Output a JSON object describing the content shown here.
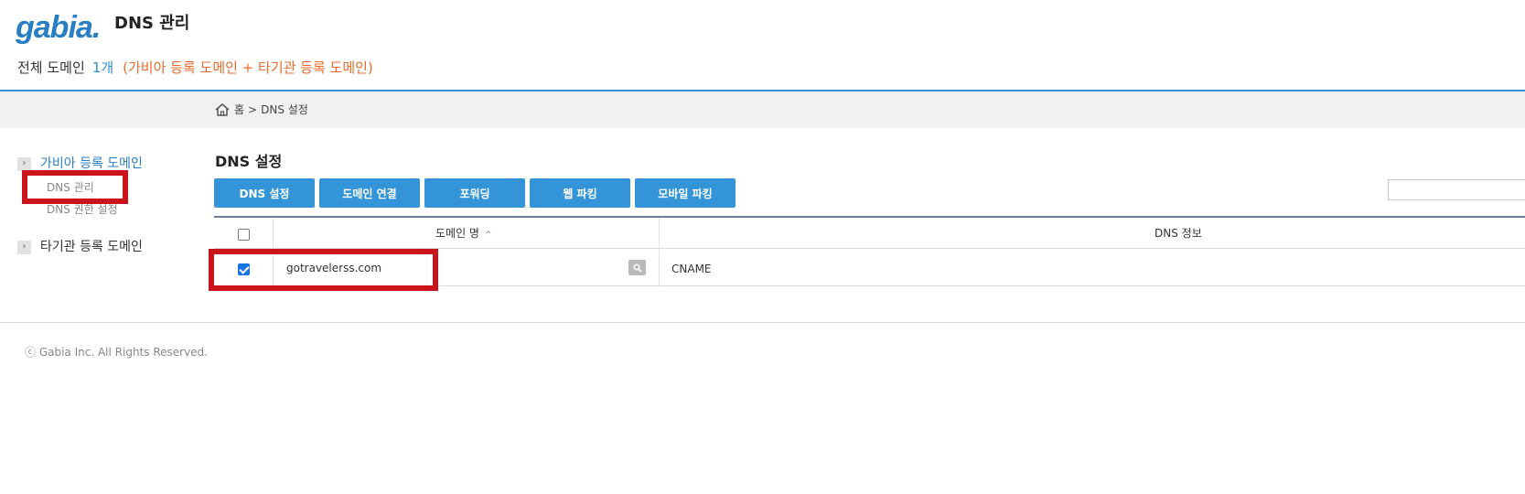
{
  "header": {
    "logo_text": "gabia",
    "logo_dot": ".",
    "title": "DNS 관리",
    "summary_label": "전체 도메인",
    "summary_count": "1개",
    "summary_note": "(가비아 등록 도메인 + 타기관 등록 도메인)"
  },
  "breadcrumb": {
    "home": "홈",
    "separator": ">",
    "current": "DNS 설정"
  },
  "sidebar": {
    "items": [
      {
        "label": "가비아 등록 도메인",
        "arrow": "›",
        "active": true
      },
      {
        "label": "타기관 등록 도메인",
        "arrow": "›",
        "active": false
      }
    ],
    "sub_items": [
      {
        "label": "DNS 관리"
      },
      {
        "label": "DNS 권한 설정"
      }
    ]
  },
  "main": {
    "section_title": "DNS 설정",
    "buttons": [
      {
        "label": "DNS 설정"
      },
      {
        "label": "도메인 연결"
      },
      {
        "label": "포워딩"
      },
      {
        "label": "웹 파킹"
      },
      {
        "label": "모바일 파킹"
      }
    ],
    "table": {
      "columns": [
        "도메인 명",
        "DNS 정보"
      ],
      "sort_indicator": "^",
      "rows": [
        {
          "checked": true,
          "domain": "gotravelerss.com",
          "dns_info": "CNAME"
        }
      ]
    }
  },
  "footer": {
    "copyright": "ⓒ Gabia Inc. All Rights Reserved."
  },
  "colors": {
    "accent": "#3395d8",
    "highlight_border": "#c8141a",
    "orange_note": "#e86c2c"
  }
}
